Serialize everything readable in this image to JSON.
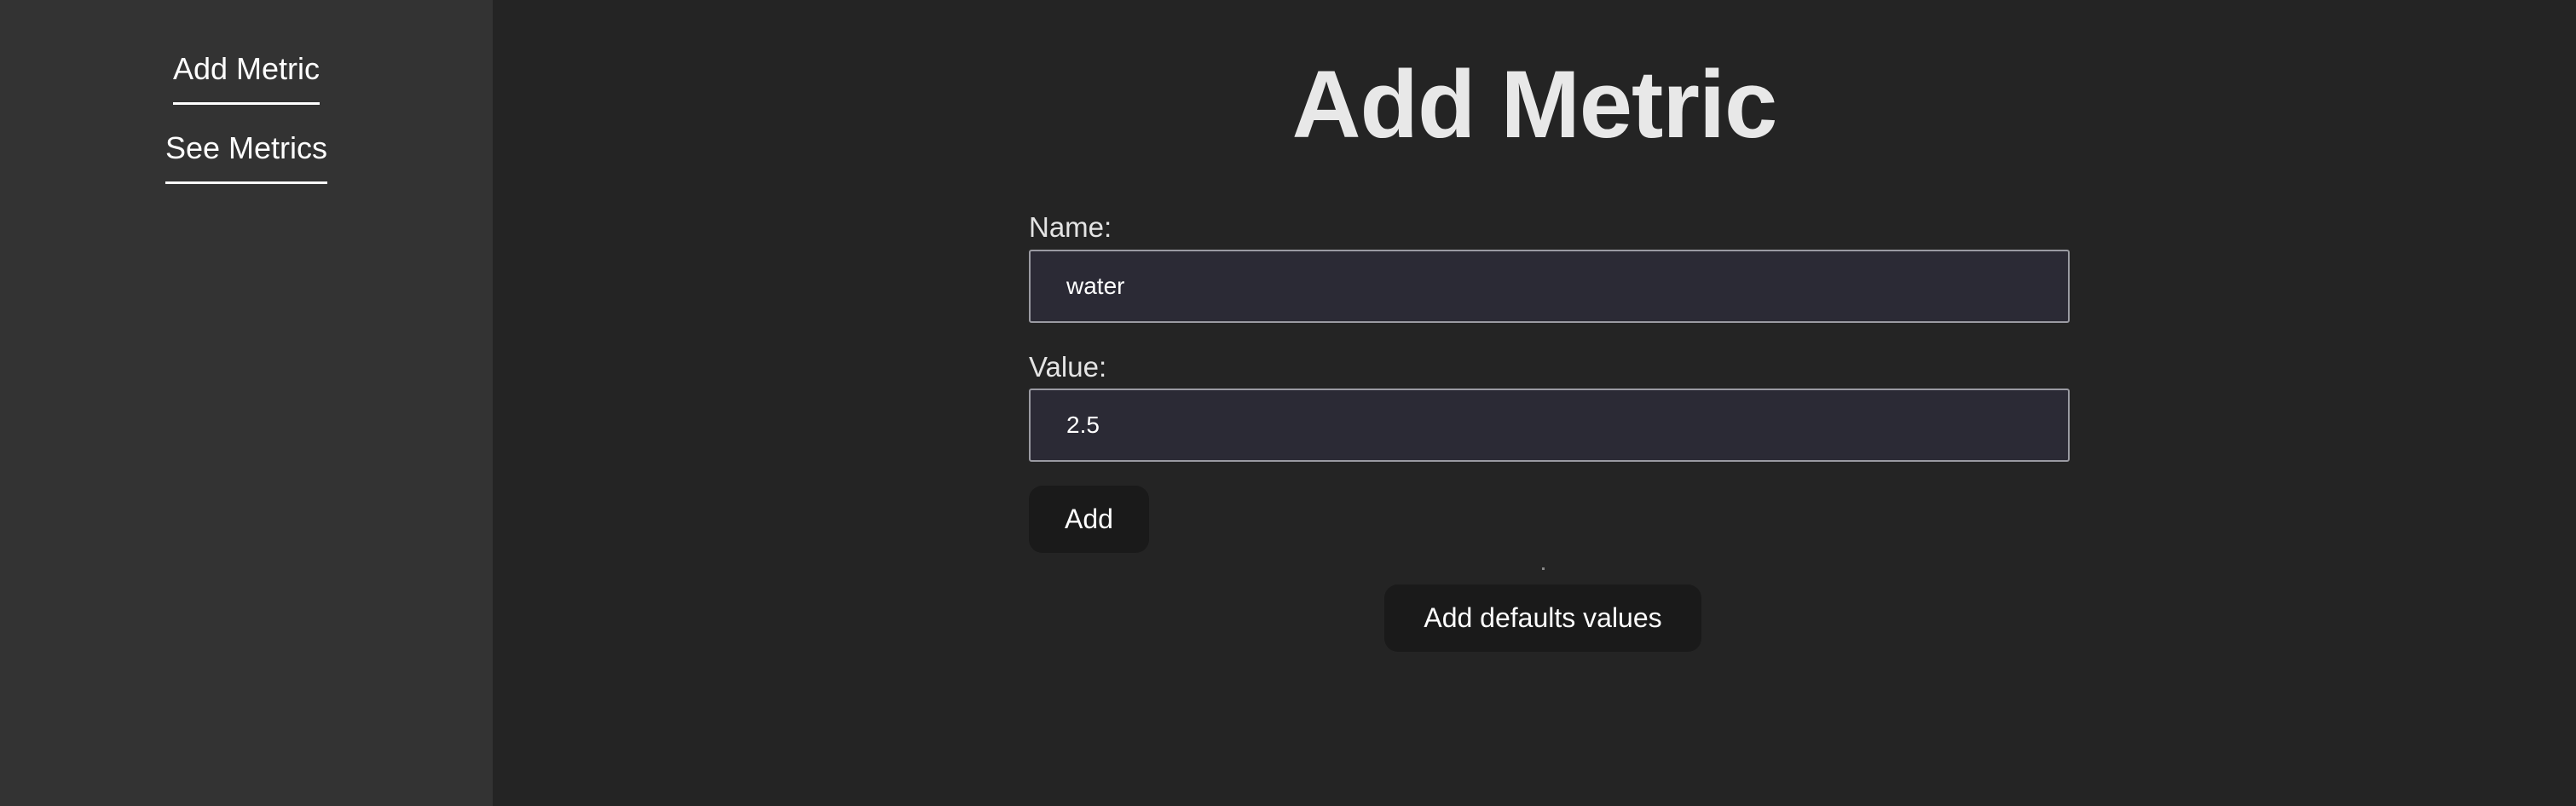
{
  "sidebar": {
    "items": [
      {
        "label": "Add Metric"
      },
      {
        "label": "See Metrics"
      }
    ]
  },
  "main": {
    "title": "Add Metric",
    "form": {
      "name_label": "Name:",
      "name_value": "water",
      "value_label": "Value:",
      "value_value": "2.5",
      "add_label": "Add"
    },
    "defaults_label": "Add defaults values"
  },
  "colors": {
    "sidebar_bg": "#333333",
    "main_bg": "#242424",
    "input_bg": "#2b2a35",
    "button_bg": "#1a1a1a"
  }
}
